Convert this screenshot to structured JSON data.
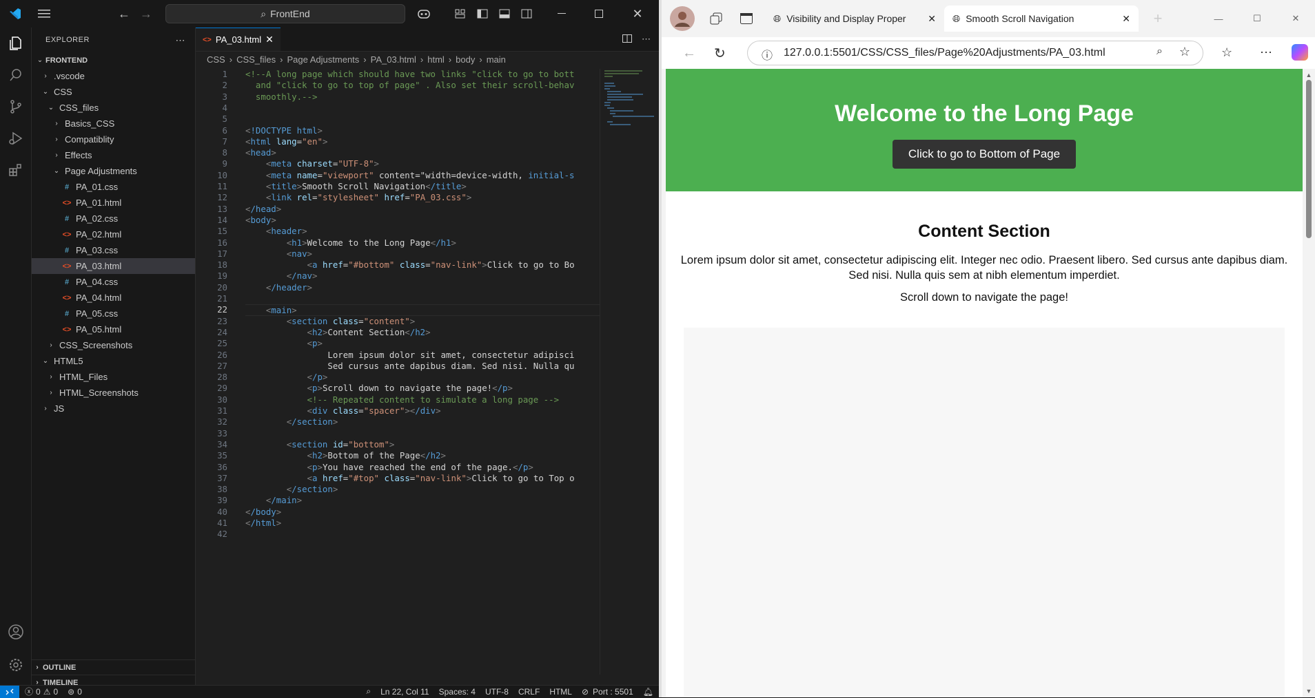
{
  "vscode": {
    "search_label": "FrontEnd",
    "explorer": {
      "title": "EXPLORER",
      "root": "FRONTEND",
      "items": [
        {
          "label": ".vscode",
          "depth": 1,
          "type": "folder",
          "open": false
        },
        {
          "label": "CSS",
          "depth": 1,
          "type": "folder",
          "open": true
        },
        {
          "label": "CSS_files",
          "depth": 2,
          "type": "folder",
          "open": true
        },
        {
          "label": "Basics_CSS",
          "depth": 3,
          "type": "folder",
          "open": false
        },
        {
          "label": "Compatiblity",
          "depth": 3,
          "type": "folder",
          "open": false
        },
        {
          "label": "Effects",
          "depth": 3,
          "type": "folder",
          "open": false
        },
        {
          "label": "Page Adjustments",
          "depth": 3,
          "type": "folder",
          "open": true
        },
        {
          "label": "PA_01.css",
          "depth": 4,
          "type": "css"
        },
        {
          "label": "PA_01.html",
          "depth": 4,
          "type": "html"
        },
        {
          "label": "PA_02.css",
          "depth": 4,
          "type": "css"
        },
        {
          "label": "PA_02.html",
          "depth": 4,
          "type": "html"
        },
        {
          "label": "PA_03.css",
          "depth": 4,
          "type": "css"
        },
        {
          "label": "PA_03.html",
          "depth": 4,
          "type": "html",
          "selected": true
        },
        {
          "label": "PA_04.css",
          "depth": 4,
          "type": "css"
        },
        {
          "label": "PA_04.html",
          "depth": 4,
          "type": "html"
        },
        {
          "label": "PA_05.css",
          "depth": 4,
          "type": "css"
        },
        {
          "label": "PA_05.html",
          "depth": 4,
          "type": "html"
        },
        {
          "label": "CSS_Screenshots",
          "depth": 2,
          "type": "folder",
          "open": false
        },
        {
          "label": "HTML5",
          "depth": 1,
          "type": "folder",
          "open": true
        },
        {
          "label": "HTML_Files",
          "depth": 2,
          "type": "folder",
          "open": false
        },
        {
          "label": "HTML_Screenshots",
          "depth": 2,
          "type": "folder",
          "open": false
        },
        {
          "label": "JS",
          "depth": 1,
          "type": "folder",
          "open": false
        }
      ],
      "outline": "OUTLINE",
      "timeline": "TIMELINE"
    },
    "tab_label": "PA_03.html",
    "breadcrumb": [
      "CSS",
      "CSS_files",
      "Page Adjustments",
      "PA_03.html",
      "html",
      "body",
      "main"
    ],
    "code_lines": [
      "<!--A long page which should have two links \"click to go to bott",
      "  and \"click to go to top of page\" . Also set their scroll-behav",
      "  smoothly.-->",
      "",
      "",
      "<!DOCTYPE html>",
      "<html lang=\"en\">",
      "<head>",
      "    <meta charset=\"UTF-8\">",
      "    <meta name=\"viewport\" content=\"width=device-width, initial-s",
      "    <title>Smooth Scroll Navigation</title>",
      "    <link rel=\"stylesheet\" href=\"PA_03.css\">",
      "</head>",
      "<body>",
      "    <header>",
      "        <h1>Welcome to the Long Page</h1>",
      "        <nav>",
      "            <a href=\"#bottom\" class=\"nav-link\">Click to go to Bo",
      "        </nav>",
      "    </header>",
      "",
      "    <main>",
      "        <section class=\"content\">",
      "            <h2>Content Section</h2>",
      "            <p>",
      "                Lorem ipsum dolor sit amet, consectetur adipisci",
      "                Sed cursus ante dapibus diam. Sed nisi. Nulla qu",
      "            </p>",
      "            <p>Scroll down to navigate the page!</p>",
      "            <!-- Repeated content to simulate a long page -->",
      "            <div class=\"spacer\"></div>",
      "        </section>",
      "",
      "        <section id=\"bottom\">",
      "            <h2>Bottom of the Page</h2>",
      "            <p>You have reached the end of the page.</p>",
      "            <a href=\"#top\" class=\"nav-link\">Click to go to Top o",
      "        </section>",
      "    </main>",
      "</body>",
      "</html>",
      ""
    ],
    "current_line": 22,
    "status": {
      "errors": "0",
      "warnings": "0",
      "ports": "0",
      "position": "Ln 22, Col 11",
      "spaces": "Spaces: 4",
      "encoding": "UTF-8",
      "eol": "CRLF",
      "language": "HTML",
      "port": "Port : 5501"
    }
  },
  "browser": {
    "tabs": [
      {
        "label": "Visibility and Display Proper",
        "active": false
      },
      {
        "label": "Smooth Scroll Navigation",
        "active": true
      }
    ],
    "url": "127.0.0.1:5501/CSS/CSS_files/Page%20Adjustments/PA_03.html",
    "page": {
      "h1": "Welcome to the Long Page",
      "nav_link": "Click to go to Bottom of Page",
      "h2": "Content Section",
      "lorem": "Lorem ipsum dolor sit amet, consectetur adipiscing elit. Integer nec odio. Praesent libero. Sed cursus ante dapibus diam. Sed nisi. Nulla quis sem at nibh elementum imperdiet.",
      "scroll_hint": "Scroll down to navigate the page!"
    }
  },
  "colors": {
    "header_green": "#4caf50",
    "vscode_bg": "#1f1f1f",
    "accent": "#0078d4"
  }
}
